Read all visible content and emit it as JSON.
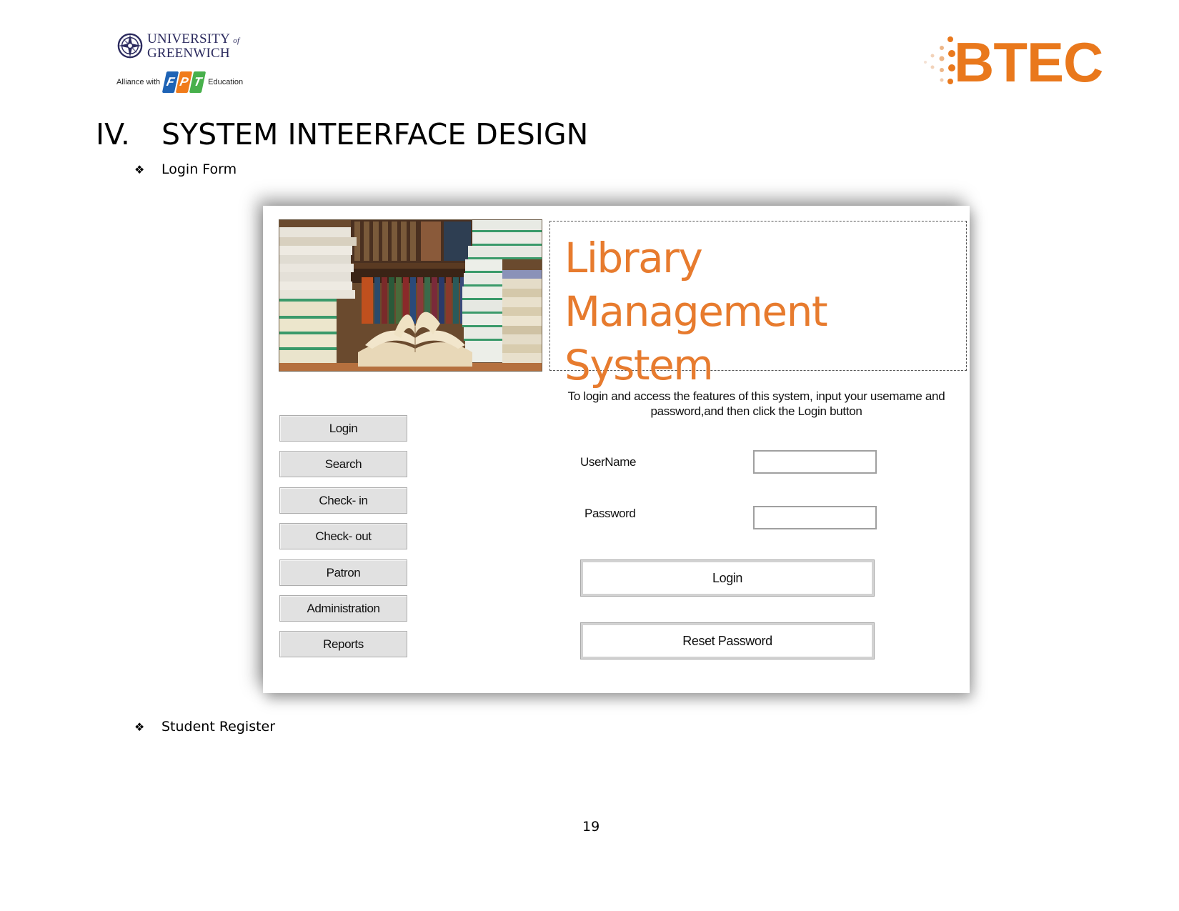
{
  "header": {
    "university_logo": {
      "line1": "UNIVERSITY",
      "of": "of",
      "line2": "GREENWICH",
      "icon": "compass-emblem-icon"
    },
    "alliance": {
      "prefix": "Alliance with",
      "brand_letters": [
        "F",
        "P",
        "T"
      ],
      "suffix": "Education"
    },
    "btec_logo": {
      "text": "BTEC",
      "color": "#e9781c"
    }
  },
  "section": {
    "number": "IV.",
    "title": "SYSTEM INTEERFACE DESIGN"
  },
  "bullets": [
    {
      "icon": "diamond-bullet-icon",
      "glyph": "❖",
      "text": "Login Form"
    },
    {
      "icon": "diamond-bullet-icon",
      "glyph": "❖",
      "text": "Student Register"
    }
  ],
  "login_form": {
    "banner_image": "library-books-photo",
    "title_line1": "Library",
    "title_line2": "Management System",
    "title_color": "#e77b2e",
    "instructions": "To login and access the features of this system, input your usemame and password,and then click the Login button",
    "nav_buttons": [
      "Login",
      "Search",
      "Check- in",
      "Check- out",
      "Patron",
      "Administration",
      "Reports"
    ],
    "username_label": "UserName",
    "username_value": "",
    "password_label": "Password",
    "password_value": "",
    "login_button": "Login",
    "reset_button": "Reset Password"
  },
  "page_number": "19"
}
